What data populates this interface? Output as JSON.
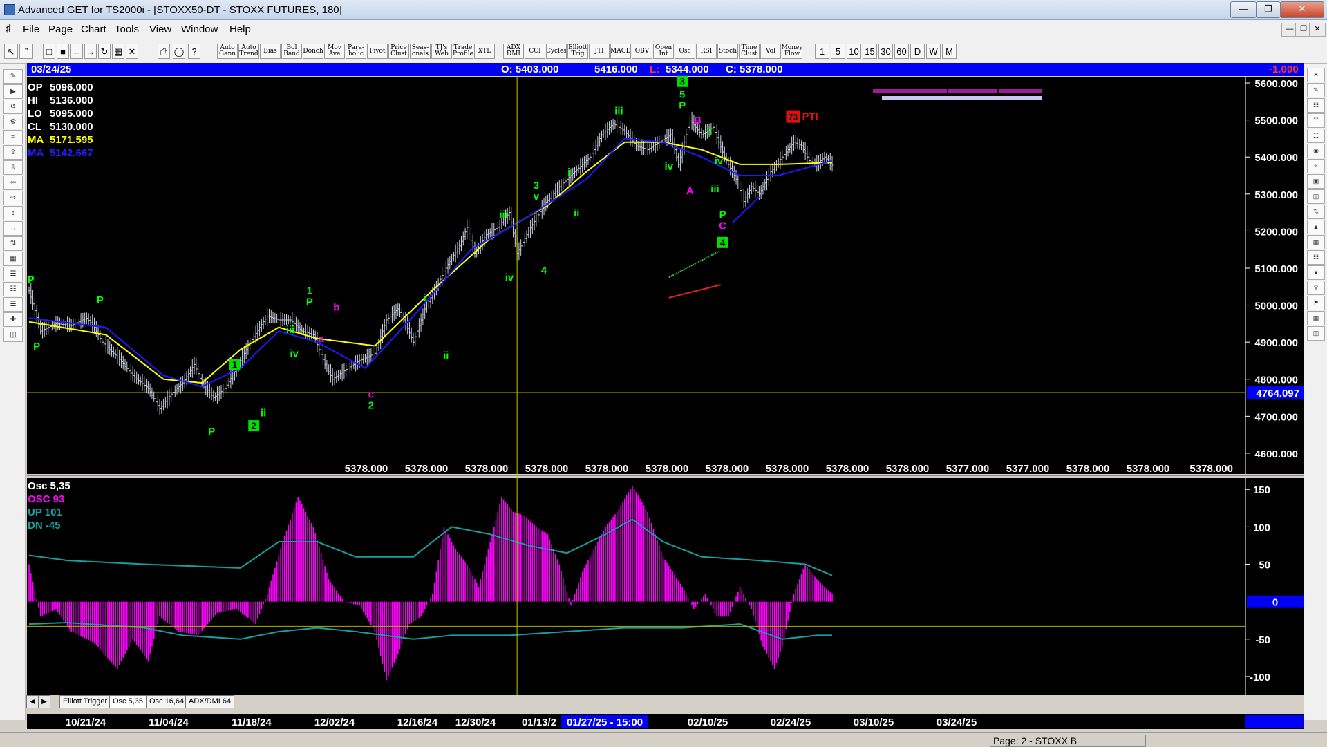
{
  "window": {
    "title": "Advanced GET for TS2000i - [STOXX50-DT - STOXX FUTURES, 180]"
  },
  "menu": [
    "File",
    "Page",
    "Chart",
    "Tools",
    "View",
    "Window",
    "Help"
  ],
  "toolbar": {
    "indicator_buttons": [
      "Auto Gann",
      "Auto Trend",
      "Bias",
      "Bol Band",
      "Donch",
      "Mov Ave",
      "Para-bolic",
      "Pivot",
      "Price Clust",
      "Seas-onals",
      "TJ's Web",
      "Trade Profile",
      "XTL",
      "ADX DMI",
      "CCI",
      "Cycles",
      "Elliott Trig",
      "JTI",
      "MACD",
      "OBV",
      "Open Int",
      "Osc",
      "RSI",
      "Stoch",
      "Time Clust",
      "Vol",
      "Money Flow"
    ],
    "interval_buttons": [
      "1",
      "5",
      "10",
      "15",
      "30",
      "60",
      "D",
      "W",
      "M"
    ]
  },
  "infobar": {
    "date": "03/24/25",
    "open": "O: 5403.000",
    "high": "5416.000",
    "low_label": "L:",
    "low": "5344.000",
    "close": "C: 5378.000",
    "change": "-1.000"
  },
  "readout": [
    {
      "label": "OP",
      "value": "5096.000",
      "color": "#ffffff"
    },
    {
      "label": "HI",
      "value": "5136.000",
      "color": "#ffffff"
    },
    {
      "label": "LO",
      "value": "5095.000",
      "color": "#ffffff"
    },
    {
      "label": "CL",
      "value": "5130.000",
      "color": "#ffffff"
    },
    {
      "label": "MA",
      "value": "5171.595",
      "color": "#ffff00"
    },
    {
      "label": "MA",
      "value": "5142.667",
      "color": "#2020ff"
    }
  ],
  "osc_readout": [
    {
      "text": "Osc 5,35",
      "color": "#ffffff"
    },
    {
      "text": "OSC 93",
      "color": "#ff00ff"
    },
    {
      "text": "UP   101",
      "color": "#16a0a0"
    },
    {
      "text": "DN   -45",
      "color": "#16a0a0"
    }
  ],
  "chart_data": {
    "type": "candlestick",
    "price_axis": {
      "ticks": [
        "5600.000",
        "5500.000",
        "5400.000",
        "5300.000",
        "5200.000",
        "5100.000",
        "5000.000",
        "4900.000",
        "4800.000",
        "4700.000",
        "4600.000"
      ],
      "range": [
        4570,
        5615
      ]
    },
    "cursor_price": "4764.097",
    "bottom_values": [
      "5378.000",
      "5378.000",
      "5378.000",
      "5378.000",
      "5378.000",
      "5378.000",
      "5378.000",
      "5378.000",
      "5378.000",
      "5378.000",
      "5377.000",
      "5377.000",
      "5378.000",
      "5378.000"
    ],
    "bottom_last": "5378.000",
    "osc_axis": {
      "ticks": [
        "150",
        "100",
        "50",
        "0",
        "-50",
        "-100"
      ],
      "range": [
        -125,
        165
      ]
    },
    "osc_zero_label": "0",
    "date_axis": {
      "labels": [
        "10/21/24",
        "11/04/24",
        "11/18/24",
        "12/02/24",
        "12/16/24",
        "12/30/24",
        "01/13/2"
      ],
      "cursor_label": "01/27/25 - 15:00",
      "labels_after": [
        "02/10/25",
        "02/24/25",
        "03/10/25",
        "03/24/25"
      ]
    },
    "price_keys": [
      [
        0,
        5040
      ],
      [
        6,
        4930
      ],
      [
        14,
        4950
      ],
      [
        22,
        4945
      ],
      [
        30,
        4965
      ],
      [
        34,
        4940
      ],
      [
        38,
        4900
      ],
      [
        46,
        4860
      ],
      [
        54,
        4810
      ],
      [
        62,
        4775
      ],
      [
        68,
        4720
      ],
      [
        74,
        4760
      ],
      [
        80,
        4790
      ],
      [
        86,
        4840
      ],
      [
        90,
        4790
      ],
      [
        96,
        4750
      ],
      [
        102,
        4775
      ],
      [
        108,
        4830
      ],
      [
        114,
        4890
      ],
      [
        120,
        4940
      ],
      [
        124,
        4970
      ],
      [
        130,
        4960
      ],
      [
        136,
        4960
      ],
      [
        142,
        4930
      ],
      [
        148,
        4920
      ],
      [
        154,
        4840
      ],
      [
        158,
        4800
      ],
      [
        166,
        4830
      ],
      [
        172,
        4850
      ],
      [
        180,
        4870
      ],
      [
        186,
        4960
      ],
      [
        192,
        4990
      ],
      [
        196,
        4950
      ],
      [
        200,
        4900
      ],
      [
        206,
        4990
      ],
      [
        212,
        5050
      ],
      [
        218,
        5110
      ],
      [
        224,
        5160
      ],
      [
        228,
        5210
      ],
      [
        232,
        5140
      ],
      [
        238,
        5190
      ],
      [
        244,
        5210
      ],
      [
        250,
        5250
      ],
      [
        254,
        5140
      ],
      [
        260,
        5200
      ],
      [
        268,
        5270
      ],
      [
        276,
        5320
      ],
      [
        284,
        5360
      ],
      [
        292,
        5400
      ],
      [
        298,
        5460
      ],
      [
        304,
        5490
      ],
      [
        310,
        5470
      ],
      [
        316,
        5430
      ],
      [
        322,
        5420
      ],
      [
        328,
        5440
      ],
      [
        334,
        5460
      ],
      [
        338,
        5380
      ],
      [
        344,
        5500
      ],
      [
        350,
        5460
      ],
      [
        356,
        5480
      ],
      [
        362,
        5400
      ],
      [
        368,
        5340
      ],
      [
        372,
        5280
      ],
      [
        376,
        5320
      ],
      [
        380,
        5300
      ],
      [
        386,
        5360
      ],
      [
        392,
        5400
      ],
      [
        398,
        5440
      ],
      [
        402,
        5430
      ],
      [
        406,
        5390
      ],
      [
        410,
        5380
      ],
      [
        414,
        5400
      ],
      [
        418,
        5378
      ]
    ],
    "ma_yellow": [
      [
        0,
        4955
      ],
      [
        40,
        4920
      ],
      [
        70,
        4800
      ],
      [
        90,
        4790
      ],
      [
        110,
        4880
      ],
      [
        130,
        4940
      ],
      [
        150,
        4910
      ],
      [
        180,
        4890
      ],
      [
        210,
        5040
      ],
      [
        240,
        5180
      ],
      [
        270,
        5270
      ],
      [
        290,
        5360
      ],
      [
        310,
        5440
      ],
      [
        330,
        5440
      ],
      [
        350,
        5420
      ],
      [
        370,
        5380
      ],
      [
        390,
        5380
      ],
      [
        418,
        5385
      ]
    ],
    "ma_blue": [
      [
        0,
        4965
      ],
      [
        40,
        4940
      ],
      [
        70,
        4810
      ],
      [
        90,
        4780
      ],
      [
        110,
        4830
      ],
      [
        130,
        4930
      ],
      [
        150,
        4900
      ],
      [
        175,
        4830
      ],
      [
        200,
        4970
      ],
      [
        230,
        5150
      ],
      [
        260,
        5240
      ],
      [
        290,
        5340
      ],
      [
        310,
        5450
      ],
      [
        330,
        5440
      ],
      [
        350,
        5400
      ],
      [
        370,
        5350
      ],
      [
        390,
        5350
      ],
      [
        418,
        5390
      ]
    ],
    "osc_keys": [
      [
        0,
        50
      ],
      [
        6,
        -20
      ],
      [
        14,
        -10
      ],
      [
        22,
        -40
      ],
      [
        34,
        -55
      ],
      [
        46,
        -90
      ],
      [
        54,
        -50
      ],
      [
        62,
        -80
      ],
      [
        68,
        -20
      ],
      [
        78,
        -40
      ],
      [
        88,
        -45
      ],
      [
        98,
        -15
      ],
      [
        108,
        -10
      ],
      [
        118,
        -30
      ],
      [
        124,
        10
      ],
      [
        132,
        80
      ],
      [
        140,
        140
      ],
      [
        148,
        100
      ],
      [
        156,
        30
      ],
      [
        164,
        0
      ],
      [
        172,
        -5
      ],
      [
        180,
        -40
      ],
      [
        186,
        -105
      ],
      [
        192,
        -70
      ],
      [
        198,
        -30
      ],
      [
        204,
        -20
      ],
      [
        210,
        10
      ],
      [
        216,
        100
      ],
      [
        222,
        70
      ],
      [
        228,
        50
      ],
      [
        234,
        20
      ],
      [
        240,
        80
      ],
      [
        246,
        140
      ],
      [
        252,
        120
      ],
      [
        258,
        115
      ],
      [
        264,
        100
      ],
      [
        270,
        90
      ],
      [
        276,
        50
      ],
      [
        282,
        -5
      ],
      [
        288,
        40
      ],
      [
        294,
        70
      ],
      [
        300,
        100
      ],
      [
        306,
        120
      ],
      [
        314,
        155
      ],
      [
        322,
        120
      ],
      [
        330,
        60
      ],
      [
        340,
        20
      ],
      [
        346,
        -10
      ],
      [
        352,
        10
      ],
      [
        358,
        -20
      ],
      [
        364,
        -20
      ],
      [
        370,
        20
      ],
      [
        376,
        -10
      ],
      [
        382,
        -60
      ],
      [
        388,
        -90
      ],
      [
        392,
        -60
      ],
      [
        398,
        10
      ],
      [
        404,
        50
      ],
      [
        410,
        30
      ],
      [
        418,
        10
      ]
    ],
    "osc_up": [
      [
        0,
        62
      ],
      [
        20,
        55
      ],
      [
        60,
        50
      ],
      [
        80,
        48
      ],
      [
        110,
        45
      ],
      [
        130,
        80
      ],
      [
        150,
        80
      ],
      [
        170,
        60
      ],
      [
        200,
        60
      ],
      [
        220,
        100
      ],
      [
        240,
        90
      ],
      [
        260,
        75
      ],
      [
        280,
        65
      ],
      [
        300,
        90
      ],
      [
        314,
        110
      ],
      [
        330,
        80
      ],
      [
        350,
        60
      ],
      [
        380,
        55
      ],
      [
        404,
        50
      ],
      [
        418,
        35
      ]
    ],
    "osc_dn": [
      [
        0,
        -30
      ],
      [
        20,
        -28
      ],
      [
        60,
        -35
      ],
      [
        80,
        -45
      ],
      [
        110,
        -50
      ],
      [
        130,
        -40
      ],
      [
        150,
        -35
      ],
      [
        170,
        -40
      ],
      [
        200,
        -50
      ],
      [
        220,
        -45
      ],
      [
        250,
        -45
      ],
      [
        280,
        -40
      ],
      [
        310,
        -35
      ],
      [
        340,
        -35
      ],
      [
        370,
        -30
      ],
      [
        392,
        -50
      ],
      [
        410,
        -45
      ],
      [
        418,
        -45
      ]
    ],
    "threshold_price": 4764.097,
    "threshold_osc": -33,
    "cursor_bar": 254,
    "labels": [
      {
        "text": "P",
        "bar": 1,
        "price": 5060,
        "color": "#00ff00"
      },
      {
        "text": "P",
        "bar": 4,
        "price": 4880,
        "color": "#00ff00"
      },
      {
        "text": "P",
        "bar": 37,
        "price": 5005,
        "color": "#00ff00"
      },
      {
        "text": "P",
        "bar": 95,
        "price": 4650,
        "color": "#00ff00"
      },
      {
        "text": "1",
        "bar": 107,
        "price": 4830,
        "color": "#00ff00",
        "boxed": true
      },
      {
        "text": "2",
        "bar": 117,
        "price": 4665,
        "color": "#00ff00",
        "boxed": true
      },
      {
        "text": "ii",
        "bar": 122,
        "price": 4700,
        "color": "#00ff00"
      },
      {
        "text": "iii",
        "bar": 136,
        "price": 4925,
        "color": "#00ff00"
      },
      {
        "text": "iv",
        "bar": 138,
        "price": 4860,
        "color": "#00ff00"
      },
      {
        "text": "1",
        "bar": 146,
        "price": 5030,
        "color": "#00ff00"
      },
      {
        "text": "P",
        "bar": 146,
        "price": 5000,
        "color": "#00ff00"
      },
      {
        "text": "b",
        "bar": 160,
        "price": 4985,
        "color": "#ff00ff"
      },
      {
        "text": "a",
        "bar": 152,
        "price": 4900,
        "color": "#ff00ff"
      },
      {
        "text": "c",
        "bar": 178,
        "price": 4750,
        "color": "#ff00ff"
      },
      {
        "text": "2",
        "bar": 178,
        "price": 4720,
        "color": "#00ff00"
      },
      {
        "text": "i",
        "bar": 206,
        "price": 5010,
        "color": "#00ff00"
      },
      {
        "text": "ii",
        "bar": 217,
        "price": 4855,
        "color": "#00ff00"
      },
      {
        "text": "iii",
        "bar": 247,
        "price": 5235,
        "color": "#00ff00"
      },
      {
        "text": "iv",
        "bar": 250,
        "price": 5065,
        "color": "#00ff00"
      },
      {
        "text": "3",
        "bar": 264,
        "price": 5315,
        "color": "#00ff00"
      },
      {
        "text": "v",
        "bar": 264,
        "price": 5285,
        "color": "#00ff00"
      },
      {
        "text": "4",
        "bar": 268,
        "price": 5085,
        "color": "#00ff00"
      },
      {
        "text": "i",
        "bar": 281,
        "price": 5350,
        "color": "#00ff00"
      },
      {
        "text": "ii",
        "bar": 285,
        "price": 5240,
        "color": "#00ff00"
      },
      {
        "text": "iii",
        "bar": 307,
        "price": 5515,
        "color": "#00ff00"
      },
      {
        "text": "iv",
        "bar": 333,
        "price": 5365,
        "color": "#00ff00"
      },
      {
        "text": "3",
        "bar": 340,
        "price": 5595,
        "color": "#00ff00",
        "boxed": true
      },
      {
        "text": "5",
        "bar": 340,
        "price": 5560,
        "color": "#00ff00"
      },
      {
        "text": "P",
        "bar": 340,
        "price": 5530,
        "color": "#00ff00"
      },
      {
        "text": "B",
        "bar": 348,
        "price": 5490,
        "color": "#ff00ff"
      },
      {
        "text": "A",
        "bar": 344,
        "price": 5300,
        "color": "#ff00ff"
      },
      {
        "text": "ii",
        "bar": 354,
        "price": 5460,
        "color": "#00ff00"
      },
      {
        "text": "iv",
        "bar": 359,
        "price": 5380,
        "color": "#00ff00"
      },
      {
        "text": "iii",
        "bar": 357,
        "price": 5305,
        "color": "#00ff00"
      },
      {
        "text": "P",
        "bar": 361,
        "price": 5235,
        "color": "#00ff00"
      },
      {
        "text": "C",
        "bar": 361,
        "price": 5205,
        "color": "#ff00ff"
      },
      {
        "text": "4",
        "bar": 361,
        "price": 5160,
        "color": "#00ff00",
        "boxed": true
      }
    ],
    "pti": {
      "value": "73",
      "text": "PTI",
      "bar": 398,
      "price": 5500
    }
  },
  "tabs": [
    "Elliott Trigger",
    "Osc 5,35",
    "Osc 16,64",
    "ADX/DMI 64"
  ],
  "status": {
    "page": "Page: 2 - STOXX B"
  },
  "colors": {
    "background": "#000000",
    "candle": "#c8d0e0",
    "ma_fast": "#ffff00",
    "ma_slow": "#1a1aff",
    "osc_hist": "#ff00ff",
    "osc_band": "#16a0a0",
    "label_green": "#00ff00",
    "label_magenta": "#ff00ff",
    "cursor": "#c8c800",
    "axis_highlight": "#0000f4"
  }
}
